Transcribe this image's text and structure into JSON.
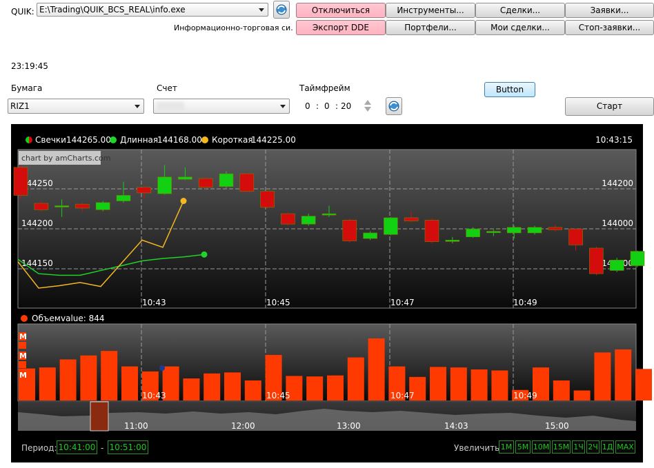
{
  "quik": {
    "label": "QUIK:",
    "path_value": "E:\\Trading\\QUIK_BCS_REAL\\info.exe",
    "subtitle": "Информационно-торговая си..."
  },
  "top_buttons": [
    {
      "label": "Отключиться",
      "style": "pink"
    },
    {
      "label": "Инструменты...",
      "style": "normal"
    },
    {
      "label": "Сделки...",
      "style": "normal"
    },
    {
      "label": "Заявки...",
      "style": "normal"
    },
    {
      "label": "Экспорт DDE",
      "style": "pink"
    },
    {
      "label": "Портфели...",
      "style": "normal"
    },
    {
      "label": "Мои сделки...",
      "style": "normal"
    },
    {
      "label": "Стоп-заявки...",
      "style": "normal"
    }
  ],
  "clock": "23:19:45",
  "security": {
    "label": "Бумага",
    "value": "RIZ1"
  },
  "account": {
    "label": "Счет",
    "value": ""
  },
  "timeframe": {
    "label": "Таймфрейм",
    "h": "0",
    "m": "0",
    "s": "20"
  },
  "button_label": "Button",
  "start_label": "Старт",
  "legend": {
    "candles_label": "Свечки",
    "candles_value": "144265.00",
    "long_label": "Длинная",
    "long_value": "144168.00",
    "short_label": "Короткая",
    "short_value": "144225.00",
    "time": "10:43:15",
    "credit": "chart by amCharts.com"
  },
  "volume_legend": {
    "label": "Объем",
    "value_text": "value: 844"
  },
  "colors": {
    "up": "#12d012",
    "down": "#d40c0c",
    "volume": "#ff3a00",
    "long_line": "#1fd42a",
    "short_line": "#f5b820",
    "panel_bg": "#000000"
  },
  "chart_data": {
    "type": "candlestick",
    "price_axis_left": {
      "ticks": [
        144250,
        144200,
        144150
      ]
    },
    "price_axis_right": {
      "ticks": [
        144200,
        144000,
        143800
      ]
    },
    "x_ticks": [
      "10:43",
      "10:45",
      "10:47",
      "10:49"
    ],
    "candles": [
      {
        "o": 144270,
        "c": 144235,
        "h": 144275,
        "l": 144230
      },
      {
        "o": 144225,
        "c": 144217,
        "h": 144228,
        "l": 144214
      },
      {
        "o": 144222,
        "c": 144222,
        "h": 144230,
        "l": 144208
      },
      {
        "o": 144224,
        "c": 144219,
        "h": 144226,
        "l": 144214
      },
      {
        "o": 144217,
        "c": 144226,
        "h": 144228,
        "l": 144215
      },
      {
        "o": 144228,
        "c": 144235,
        "h": 144252,
        "l": 144226
      },
      {
        "o": 144245,
        "c": 144238,
        "h": 144247,
        "l": 144231
      },
      {
        "o": 144237,
        "c": 144258,
        "h": 144273,
        "l": 144236
      },
      {
        "o": 144255,
        "c": 144258,
        "h": 144270,
        "l": 144254
      },
      {
        "o": 144256,
        "c": 144245,
        "h": 144258,
        "l": 144243
      },
      {
        "o": 144246,
        "c": 144262,
        "h": 144265,
        "l": 144244
      },
      {
        "o": 144262,
        "c": 144240,
        "h": 144265,
        "l": 144238
      },
      {
        "o": 144240,
        "c": 144220,
        "h": 144242,
        "l": 144218
      },
      {
        "o": 144212,
        "c": 144199,
        "h": 144214,
        "l": 144197
      },
      {
        "o": 144199,
        "c": 144209,
        "h": 144212,
        "l": 144197
      },
      {
        "o": 144212,
        "c": 144212,
        "h": 144222,
        "l": 144208
      },
      {
        "o": 144204,
        "c": 144178,
        "h": 144206,
        "l": 144176
      },
      {
        "o": 144181,
        "c": 144188,
        "h": 144190,
        "l": 144179
      },
      {
        "o": 144186,
        "c": 144207,
        "h": 144208,
        "l": 144185
      },
      {
        "o": 144207,
        "c": 144203,
        "h": 144215,
        "l": 144201
      },
      {
        "o": 144204,
        "c": 144177,
        "h": 144206,
        "l": 144175
      },
      {
        "o": 144179,
        "c": 144179,
        "h": 144183,
        "l": 144175
      },
      {
        "o": 144183,
        "c": 144193,
        "h": 144195,
        "l": 144182
      },
      {
        "o": 144189,
        "c": 144190,
        "h": 144192,
        "l": 144184
      },
      {
        "o": 144188,
        "c": 144195,
        "h": 144197,
        "l": 144181
      },
      {
        "o": 144188,
        "c": 144195,
        "h": 144197,
        "l": 144186
      },
      {
        "o": 144195,
        "c": 144192,
        "h": 144198,
        "l": 144190
      },
      {
        "o": 144193,
        "c": 144173,
        "h": 144194,
        "l": 144166
      },
      {
        "o": 144169,
        "c": 144137,
        "h": 144171,
        "l": 144135
      },
      {
        "o": 144141,
        "c": 144154,
        "h": 144157,
        "l": 144139
      },
      {
        "o": 144147,
        "c": 144165,
        "h": 144166,
        "l": 144145
      }
    ],
    "long_line": [
      144155,
      144137,
      144135,
      144135,
      144141,
      144147,
      144153,
      144156,
      144158,
      144161
    ],
    "short_line": [
      144152,
      144119,
      144122,
      144126,
      144121,
      144150,
      144179,
      144170,
      144228
    ],
    "volume": [
      640,
      660,
      820,
      900,
      990,
      680,
      580,
      680,
      440,
      540,
      560,
      400,
      910,
      490,
      480,
      500,
      860,
      1240,
      680,
      470,
      670,
      660,
      620,
      600,
      210,
      660,
      400,
      200,
      960,
      1020,
      630,
      700
    ],
    "volume_ticks": [
      "10:43",
      "10:45",
      "10:47",
      "10:49"
    ],
    "navigator_ticks": [
      "11:00",
      "12:00",
      "13:00",
      "14:03",
      "15:00"
    ]
  },
  "footer": {
    "period_label": "Период:",
    "from": "10:41:00",
    "dash": "-",
    "to": "10:51:00",
    "zoom_label": "Увеличить:",
    "zoom_buttons": [
      "1M",
      "5M",
      "10M",
      "15M",
      "1Ч",
      "2Ч",
      "1Д",
      "MAX"
    ]
  }
}
